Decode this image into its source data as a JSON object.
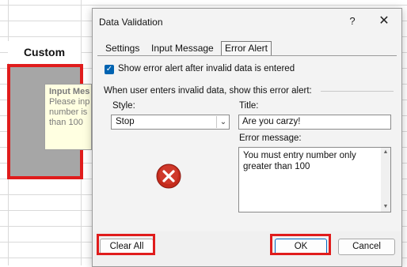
{
  "sheet": {
    "header": "Custom",
    "tooltip_title": "Input Mes",
    "tooltip_lines": [
      "Please inp",
      "number is",
      "than 100"
    ]
  },
  "dialog": {
    "title": "Data Validation",
    "help_icon": "?",
    "close_icon": "✕",
    "tabs": [
      "Settings",
      "Input Message",
      "Error Alert"
    ],
    "active_tab": "Error Alert",
    "show_alert_checked": true,
    "show_alert_label": "Show error alert after invalid data is entered",
    "section_label": "When user enters invalid data, show this error alert:",
    "style_label": "Style:",
    "style_value": "Stop",
    "style_icon": "chevron-down-icon",
    "title_label": "Title:",
    "title_value": "Are you carzy!",
    "error_label": "Error message:",
    "error_value": "You must entry number only greater than 100",
    "alert_icon": "stop-error-icon",
    "buttons": {
      "clear_all": "Clear All",
      "ok": "OK",
      "cancel": "Cancel"
    }
  },
  "colors": {
    "highlight": "#e01c1c",
    "accent": "#0063b1",
    "stop_icon": "#c42b1c"
  }
}
